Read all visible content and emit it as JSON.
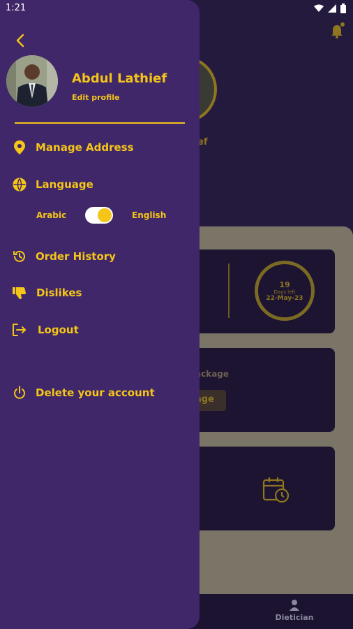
{
  "status_bar": {
    "time": "1:21"
  },
  "profile": {
    "name": "Abdul Lathief",
    "edit_label": "Edit profile"
  },
  "menu": {
    "manage_address": "Manage Address",
    "language": "Language",
    "language_options": {
      "left": "Arabic",
      "right": "English",
      "selected": "English"
    },
    "order_history": "Order History",
    "dislikes": "Dislikes",
    "logout": "Logout",
    "delete_account": "Delete your account"
  },
  "background": {
    "name_tail": "ef",
    "days_left_value": "19",
    "days_left_label": "Days left",
    "end_date": "22-May-23",
    "package_label_tail": "ackage",
    "package_button_tail": "age",
    "nav_dietician": "Dietician"
  },
  "colors": {
    "accent": "#f5c518",
    "drawer_bg": "#3f2769",
    "app_bg": "#1e1433"
  }
}
